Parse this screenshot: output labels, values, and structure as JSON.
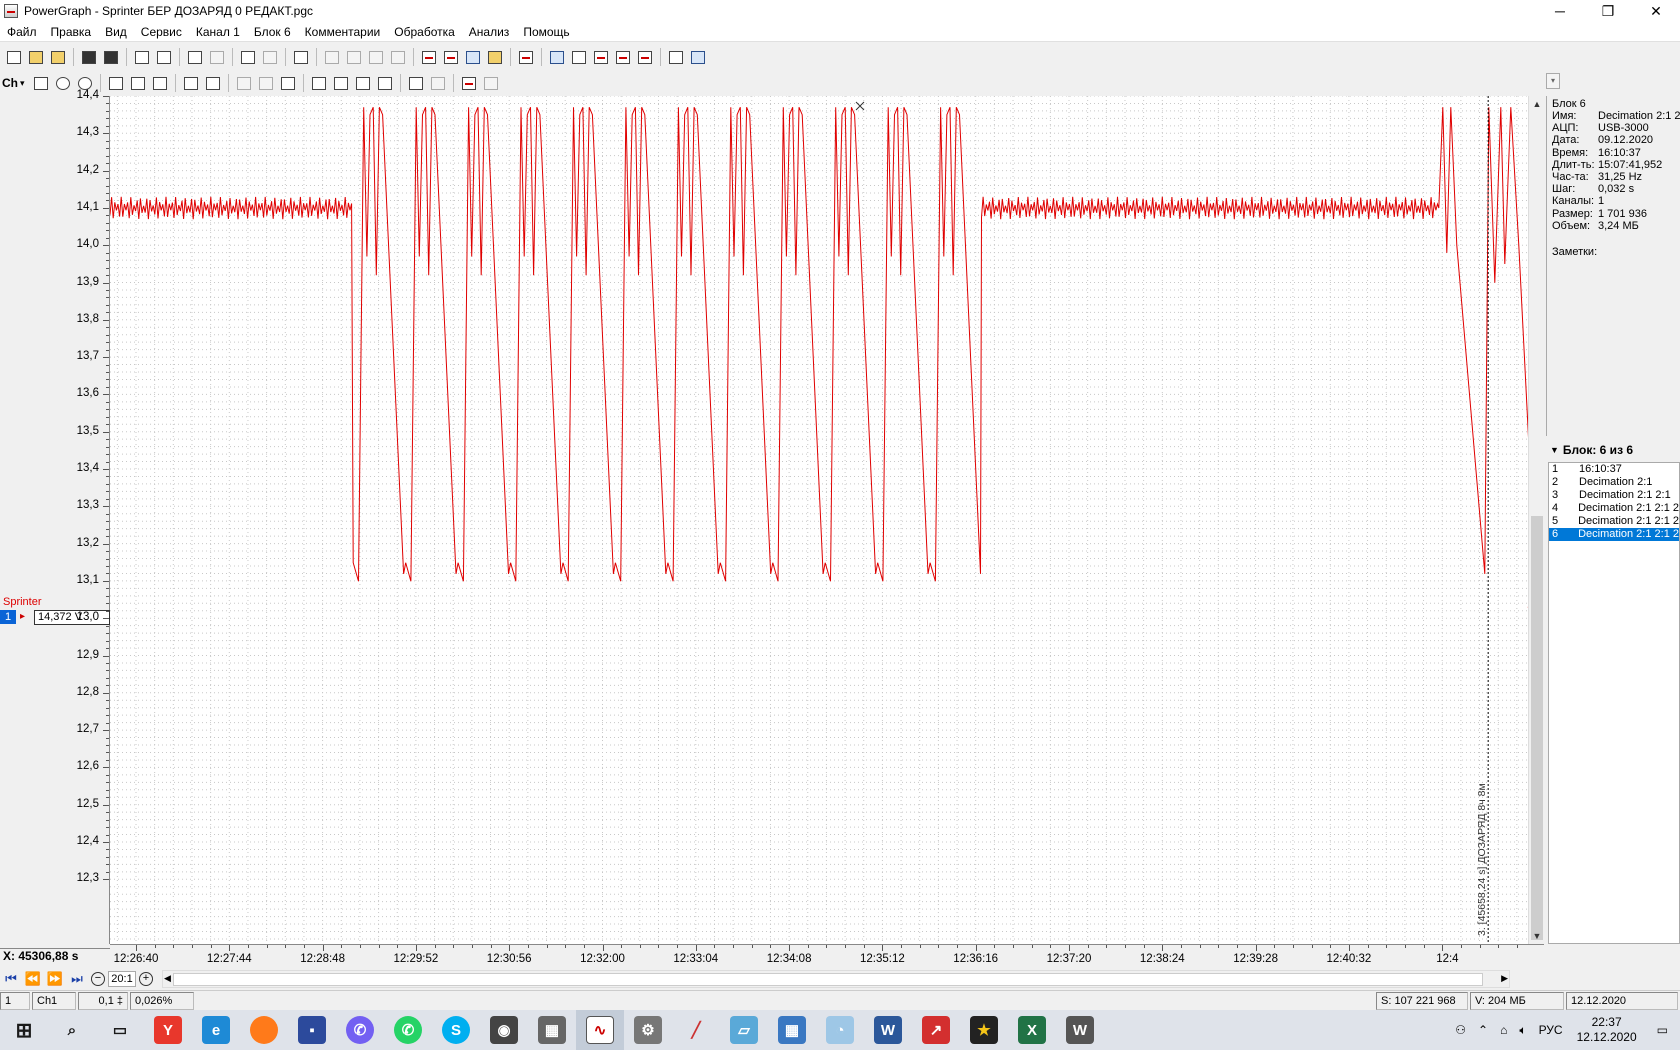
{
  "window": {
    "title": "PowerGraph - Sprinter БЕР ДОЗАРЯД 0 РЕДАКТ.pgc",
    "minimize": "─",
    "maximize": "❐",
    "close": "✕"
  },
  "menu": [
    "Файл",
    "Правка",
    "Вид",
    "Сервис",
    "Канал 1",
    "Блок 6",
    "Комментарии",
    "Обработка",
    "Анализ",
    "Помощь"
  ],
  "toolbar2": {
    "channel_label": "Ch",
    "channel_drop": "▾"
  },
  "channel": {
    "name": "Sprinter",
    "number": "1",
    "arrow": "▸",
    "value": "14,372 V"
  },
  "y_ticks": [
    "14,4",
    "14,3",
    "14,2",
    "14,1",
    "14,0",
    "13,9",
    "13,8",
    "13,7",
    "13,6",
    "13,5",
    "13,4",
    "13,3",
    "13,2",
    "13,1",
    "13,0",
    "12,9",
    "12,8",
    "12,7",
    "12,6",
    "12,5",
    "12,4",
    "12,3"
  ],
  "x_ticks": [
    "12:26:40",
    "12:27:44",
    "12:28:48",
    "12:29:52",
    "12:30:56",
    "12:32:00",
    "12:33:04",
    "12:34:08",
    "12:35:12",
    "12:36:16",
    "12:37:20",
    "12:38:24",
    "12:39:28",
    "12:40:32",
    "12:4"
  ],
  "x_readout": "X: 45306,88 s",
  "marker_label": "3. [45658,24 s] ДОЗАРЯД 8ч 8м",
  "info": {
    "block": "Блок 6",
    "rows": [
      {
        "k": "Имя:",
        "v": "Decimation 2:1 2:"
      },
      {
        "k": "АЦП:",
        "v": "USB-3000"
      },
      {
        "k": "Дата:",
        "v": "09.12.2020"
      },
      {
        "k": "Время:",
        "v": "16:10:37"
      },
      {
        "k": "Длит-ть:",
        "v": "15:07:41,952"
      },
      {
        "k": "Час-та:",
        "v": "31,25 Hz"
      },
      {
        "k": "Шаг:",
        "v": "0,032 s"
      },
      {
        "k": "Каналы:",
        "v": "1"
      },
      {
        "k": "Размер:",
        "v": "1 701 936"
      },
      {
        "k": "Объем:",
        "v": "3,24 МБ"
      }
    ],
    "notes_label": "Заметки:"
  },
  "block_panel": {
    "header": "Блок: 6 из 6",
    "items": [
      {
        "n": "1",
        "label": "16:10:37"
      },
      {
        "n": "2",
        "label": "Decimation 2:1"
      },
      {
        "n": "3",
        "label": "Decimation 2:1 2:1"
      },
      {
        "n": "4",
        "label": "Decimation 2:1 2:1 2"
      },
      {
        "n": "5",
        "label": "Decimation 2:1 2:1 2"
      },
      {
        "n": "6",
        "label": "Decimation 2:1 2:1 2"
      }
    ],
    "selected": 5
  },
  "navbar": {
    "zoom": "20:1",
    "zoom_out": "−",
    "zoom_in": "+"
  },
  "status": {
    "s1": "1",
    "s2": "Ch1",
    "s3": "0,1 ‡",
    "s4": "0,026%",
    "s5": "S: 107 221 968",
    "s6": "V: 204 МБ",
    "s7": "12.12.2020"
  },
  "taskbar": {
    "lang": "РУС",
    "time": "22:37",
    "date": "12.12.2020"
  },
  "colors": {
    "trace": "#e00000",
    "grid": "#c8c8c8",
    "selection": "#0078d7"
  },
  "chart_data": {
    "type": "line",
    "series": [
      {
        "name": "Sprinter",
        "unit": "V"
      }
    ],
    "ylim": [
      12.3,
      14.4
    ],
    "xlim": [
      "12:26:10",
      "12:41:00"
    ],
    "grid": true,
    "segments": [
      {
        "from": "12:26:10",
        "to": "12:28:42",
        "pattern": "flat-noisy",
        "mean": 14.1,
        "amplitude": 0.03
      },
      {
        "from": "12:28:42",
        "to": "12:35:17",
        "pattern": "sawtooth-oscillation",
        "max": 14.37,
        "min": 13.1,
        "cycles": 12
      },
      {
        "from": "12:35:17",
        "to": "12:40:04",
        "pattern": "flat-noisy",
        "mean": 14.1,
        "amplitude": 0.03
      },
      {
        "from": "12:40:04",
        "to": "12:41:00",
        "pattern": "oscillation-then-decay",
        "max": 14.37,
        "min": 13.03,
        "end": 13.03
      }
    ],
    "marker": {
      "x": "12:40:35",
      "label": "3. [45658,24 s] ДОЗАРЯД 8ч 8м"
    }
  }
}
